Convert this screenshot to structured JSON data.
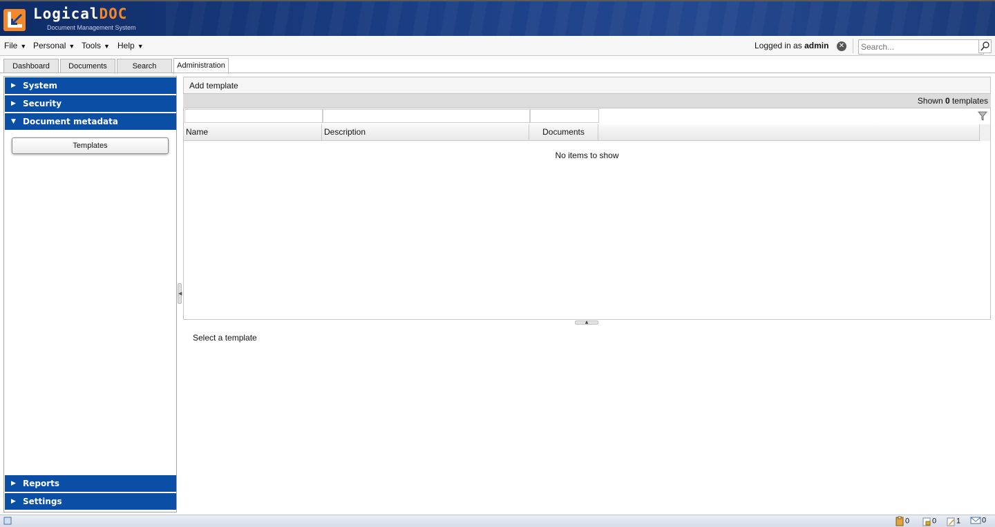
{
  "app": {
    "logo_main": "Logical",
    "logo_accent": "DOC",
    "logo_subtitle": "Document Management System"
  },
  "menubar": {
    "items": [
      {
        "label": "File"
      },
      {
        "label": "Personal"
      },
      {
        "label": "Tools"
      },
      {
        "label": "Help"
      }
    ],
    "logged_prefix": "Logged in as ",
    "logged_user": "admin",
    "search_placeholder": "Search..."
  },
  "tabs": [
    {
      "label": "Dashboard"
    },
    {
      "label": "Documents"
    },
    {
      "label": "Search"
    },
    {
      "label": "Administration",
      "active": true
    }
  ],
  "sidebar": {
    "sections": [
      {
        "label": "System",
        "expanded": false
      },
      {
        "label": "Security",
        "expanded": false
      },
      {
        "label": "Document metadata",
        "expanded": true
      },
      {
        "label": "Reports",
        "expanded": false
      },
      {
        "label": "Settings",
        "expanded": false
      }
    ],
    "templates_button": "Templates"
  },
  "main": {
    "add_template_label": "Add template",
    "shown_prefix": "Shown ",
    "shown_count": "0",
    "shown_suffix": " templates",
    "columns": [
      "Name",
      "Description",
      "Documents"
    ],
    "empty_message": "No items to show",
    "detail_message": "Select a template"
  },
  "statusbar": {
    "clipboard_count": "0",
    "locked_count": "0",
    "checkout_count": "1",
    "messages_count": "0"
  },
  "colors": {
    "accent_blue": "#0a4ea6",
    "logo_orange": "#f2892a",
    "banner_dark": "#0f2c66"
  }
}
